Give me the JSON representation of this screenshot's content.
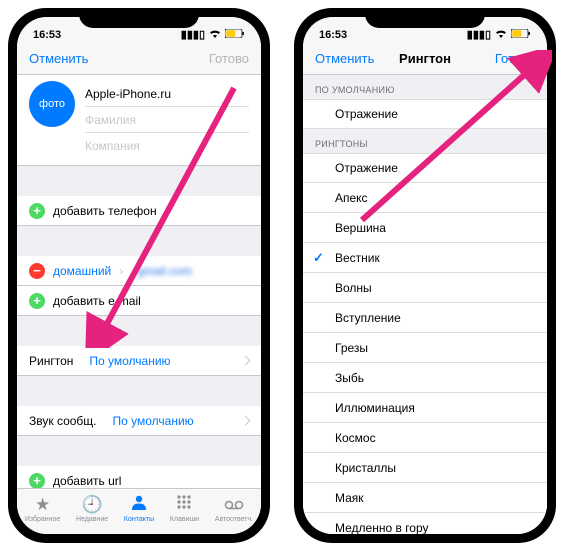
{
  "status": {
    "time": "16:53"
  },
  "left": {
    "nav": {
      "cancel": "Отменить",
      "done": "Готово"
    },
    "photo_label": "фото",
    "name_value": "Apple-iPhone.ru",
    "lastname_placeholder": "Фамилия",
    "company_placeholder": "Компания",
    "add_phone": "добавить телефон",
    "email_type": "домашний",
    "email_value": "gmail.com",
    "add_email": "добавить e-mail",
    "ringtone_label": "Рингтон",
    "ringtone_value": "По умолчанию",
    "textsound_label": "Звук сообщ.",
    "textsound_value": "По умолчанию",
    "add_url": "добавить url",
    "tabs": {
      "favorites": "Избранное",
      "recents": "Недавние",
      "contacts": "Контакты",
      "keypad": "Клавиши",
      "voicemail": "Автоответч."
    }
  },
  "right": {
    "nav": {
      "cancel": "Отменить",
      "title": "Рингтон",
      "done": "Готово"
    },
    "section_default": "ПО УМОЛЧАНИЮ",
    "default_tone": "Отражение",
    "section_ringtones": "РИНГТОНЫ",
    "tones": [
      "Отражение",
      "Апекс",
      "Вершина",
      "Вестник",
      "Волны",
      "Вступление",
      "Грезы",
      "Зыбь",
      "Иллюминация",
      "Космос",
      "Кристаллы",
      "Маяк",
      "Медленно в гору"
    ],
    "selected_index": 3
  }
}
